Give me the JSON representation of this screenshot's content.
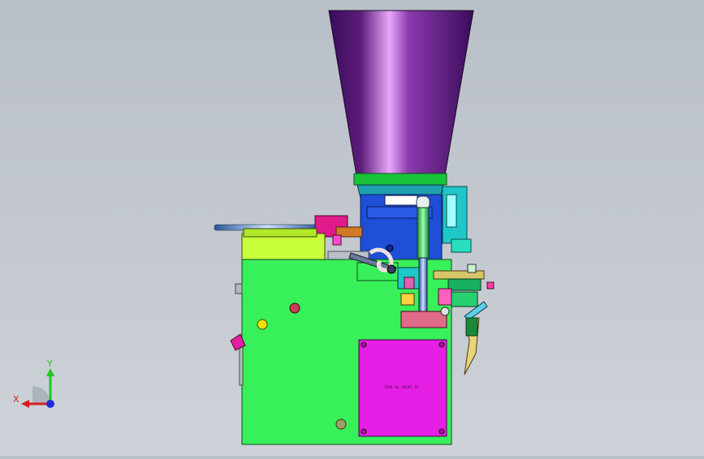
{
  "viewport": {
    "model": "filling-machine-assembly",
    "background": [
      "#b9bfc7",
      "#ced3d9"
    ]
  },
  "colors": {
    "hopper": "#5b1c7a",
    "hopper_highlight": "#e8a8f8",
    "green_band": "#19c43a",
    "blue_block": "#1f4fd6",
    "frame": "#38f05a",
    "lime_box": "#c8ff3a",
    "magenta_plate": "#e61ee6",
    "cyan_part": "#1ec8c8",
    "pink_block": "#e06a8a",
    "rod": "#3a7ad0",
    "gold_part": "#d7c56a"
  },
  "parts": {
    "nameplate_text": "PLNL-DL-VDGDT 01",
    "hopper_icon": "cone-hopper-icon",
    "arm_icon": "hook-arm-icon"
  },
  "triad": {
    "x_label": "X",
    "y_label": "Y",
    "x_color": "#d81e1e",
    "y_color": "#1ec81e",
    "z_color": "#1e2ed8"
  }
}
